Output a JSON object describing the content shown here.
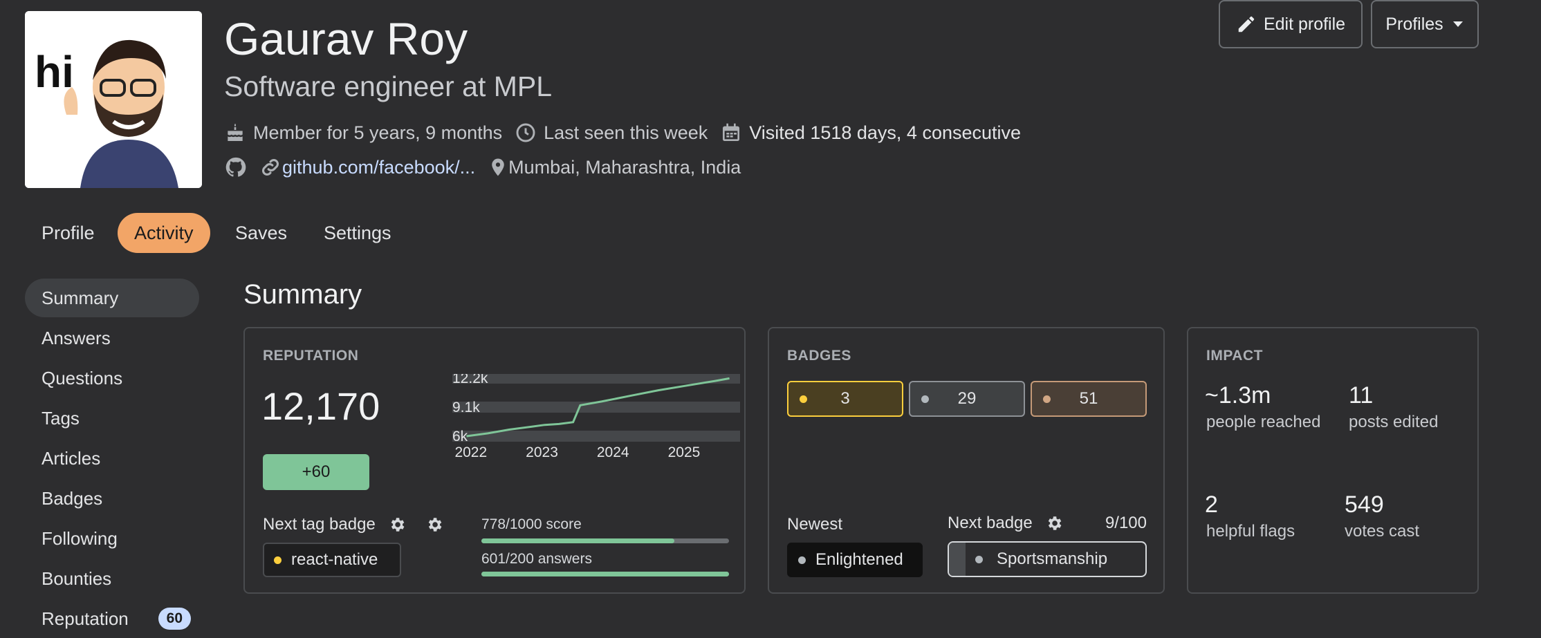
{
  "user": {
    "name": "Gaurav Roy",
    "tagline": "Software engineer at MPL",
    "member_for": "Member for 5 years, 9 months",
    "last_seen": "Last seen this week",
    "visited": "Visited 1518 days, 4 consecutive",
    "website": "github.com/facebook/...",
    "location": "Mumbai, Maharashtra, India"
  },
  "header_buttons": {
    "edit_profile": "Edit profile",
    "profiles": "Profiles"
  },
  "tabs": [
    {
      "label": "Profile",
      "active": false
    },
    {
      "label": "Activity",
      "active": true
    },
    {
      "label": "Saves",
      "active": false
    },
    {
      "label": "Settings",
      "active": false
    }
  ],
  "sidebar": {
    "items": [
      {
        "label": "Summary",
        "active": true
      },
      {
        "label": "Answers"
      },
      {
        "label": "Questions"
      },
      {
        "label": "Tags"
      },
      {
        "label": "Articles"
      },
      {
        "label": "Badges"
      },
      {
        "label": "Following"
      },
      {
        "label": "Bounties"
      },
      {
        "label": "Reputation",
        "count": "60"
      }
    ]
  },
  "section_title": "Summary",
  "reputation": {
    "title": "REPUTATION",
    "value": "12,170",
    "change": "+60",
    "next_tag_badge_label": "Next tag badge",
    "tag": "react-native",
    "score_progress_text": "778/1000 score",
    "score_progress": 0.778,
    "answers_progress_text": "601/200 answers",
    "answers_progress": 1.0
  },
  "chart_data": {
    "type": "line",
    "x_ticks": [
      "2022",
      "2023",
      "2024",
      "2025"
    ],
    "y_ticks": [
      "12.2k",
      "9.1k",
      "6k"
    ],
    "ylim": [
      6000,
      12200
    ],
    "grid": true,
    "series": [
      {
        "x": [
          2021.9,
          2022.2,
          2022.5,
          2022.8,
          2023.0,
          2023.2,
          2023.4,
          2023.5,
          2023.8,
          2024.2,
          2024.6,
          2025.0,
          2025.4,
          2025.6
        ],
        "y": [
          6000,
          6300,
          6700,
          7000,
          7200,
          7300,
          7500,
          9300,
          9700,
          10300,
          10900,
          11400,
          11900,
          12170
        ]
      }
    ],
    "colors": {
      "line": "#7fc598",
      "grid": "#45474a"
    }
  },
  "badges": {
    "title": "BADGES",
    "gold": "3",
    "silver": "29",
    "bronze": "51",
    "newest_label": "Newest",
    "newest_badge": "Enlightened",
    "next_badge_label": "Next badge",
    "next_badge_progress": "9/100",
    "next_badge": "Sportsmanship",
    "colors": {
      "gold": "#fccf3d",
      "silver": "#b2b8bd",
      "bronze": "#d1a684"
    }
  },
  "impact": {
    "title": "IMPACT",
    "reached_value": "~1.3m",
    "reached_label": "people reached",
    "edited_value": "11",
    "edited_label": "posts edited",
    "flags_value": "2",
    "flags_label": "helpful flags",
    "votes_value": "549",
    "votes_label": "votes cast"
  },
  "icons": [
    "cake-icon",
    "clock-icon",
    "calendar-icon",
    "github-icon",
    "link-icon",
    "location-icon",
    "pencil-icon",
    "caret-down-icon",
    "gear-icon"
  ]
}
